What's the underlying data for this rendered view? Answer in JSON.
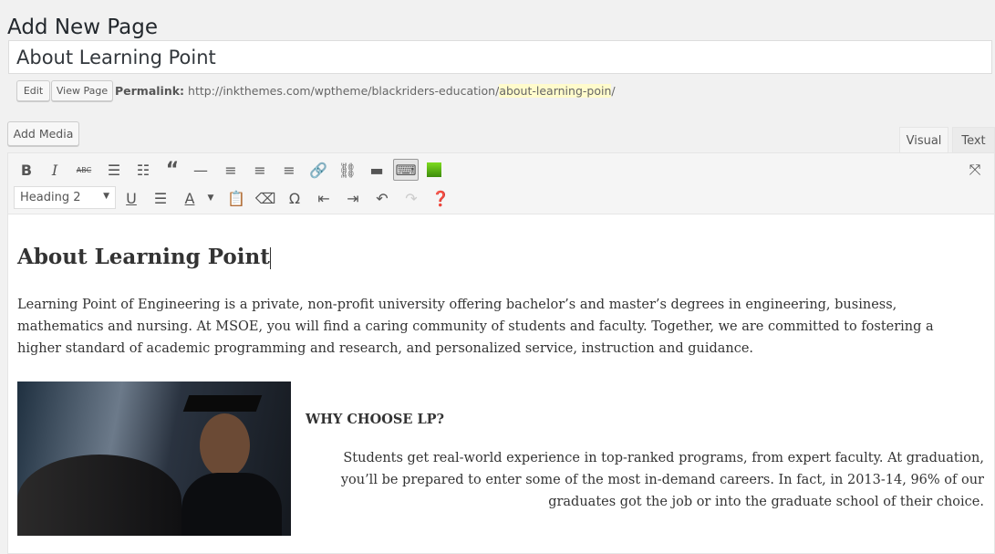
{
  "header": {
    "title": "Add New Page"
  },
  "post_title": "About Learning Point",
  "permalink": {
    "edit": "Edit",
    "view": "View Page",
    "label": "Permalink:",
    "base": "http://inkthemes.com/wptheme/blackriders-education/",
    "slug": "about-learning-poin",
    "trail": "/"
  },
  "add_media": "Add Media",
  "tabs": {
    "visual": "Visual",
    "text": "Text"
  },
  "toolbar": {
    "format": "Heading 2"
  },
  "content": {
    "heading": "About Learning Point",
    "paragraph": "Learning Point of Engineering is a private, non-profit university offering bachelor’s and master’s degrees in engineering, business, mathematics and nursing. At MSOE, you will find a caring community of students and faculty. Together, we are committed to fostering a higher standard of academic programming and research, and personalized service, instruction and guidance.",
    "subheading": "WHY CHOOSE LP?",
    "side_paragraph": "Students get real-world experience in top-ranked programs, from expert faculty. At graduation, you’ll be prepared to enter some of the most in-demand careers. In fact, in 2013-14, 96% of our graduates got the job or into the graduate school of their choice."
  }
}
